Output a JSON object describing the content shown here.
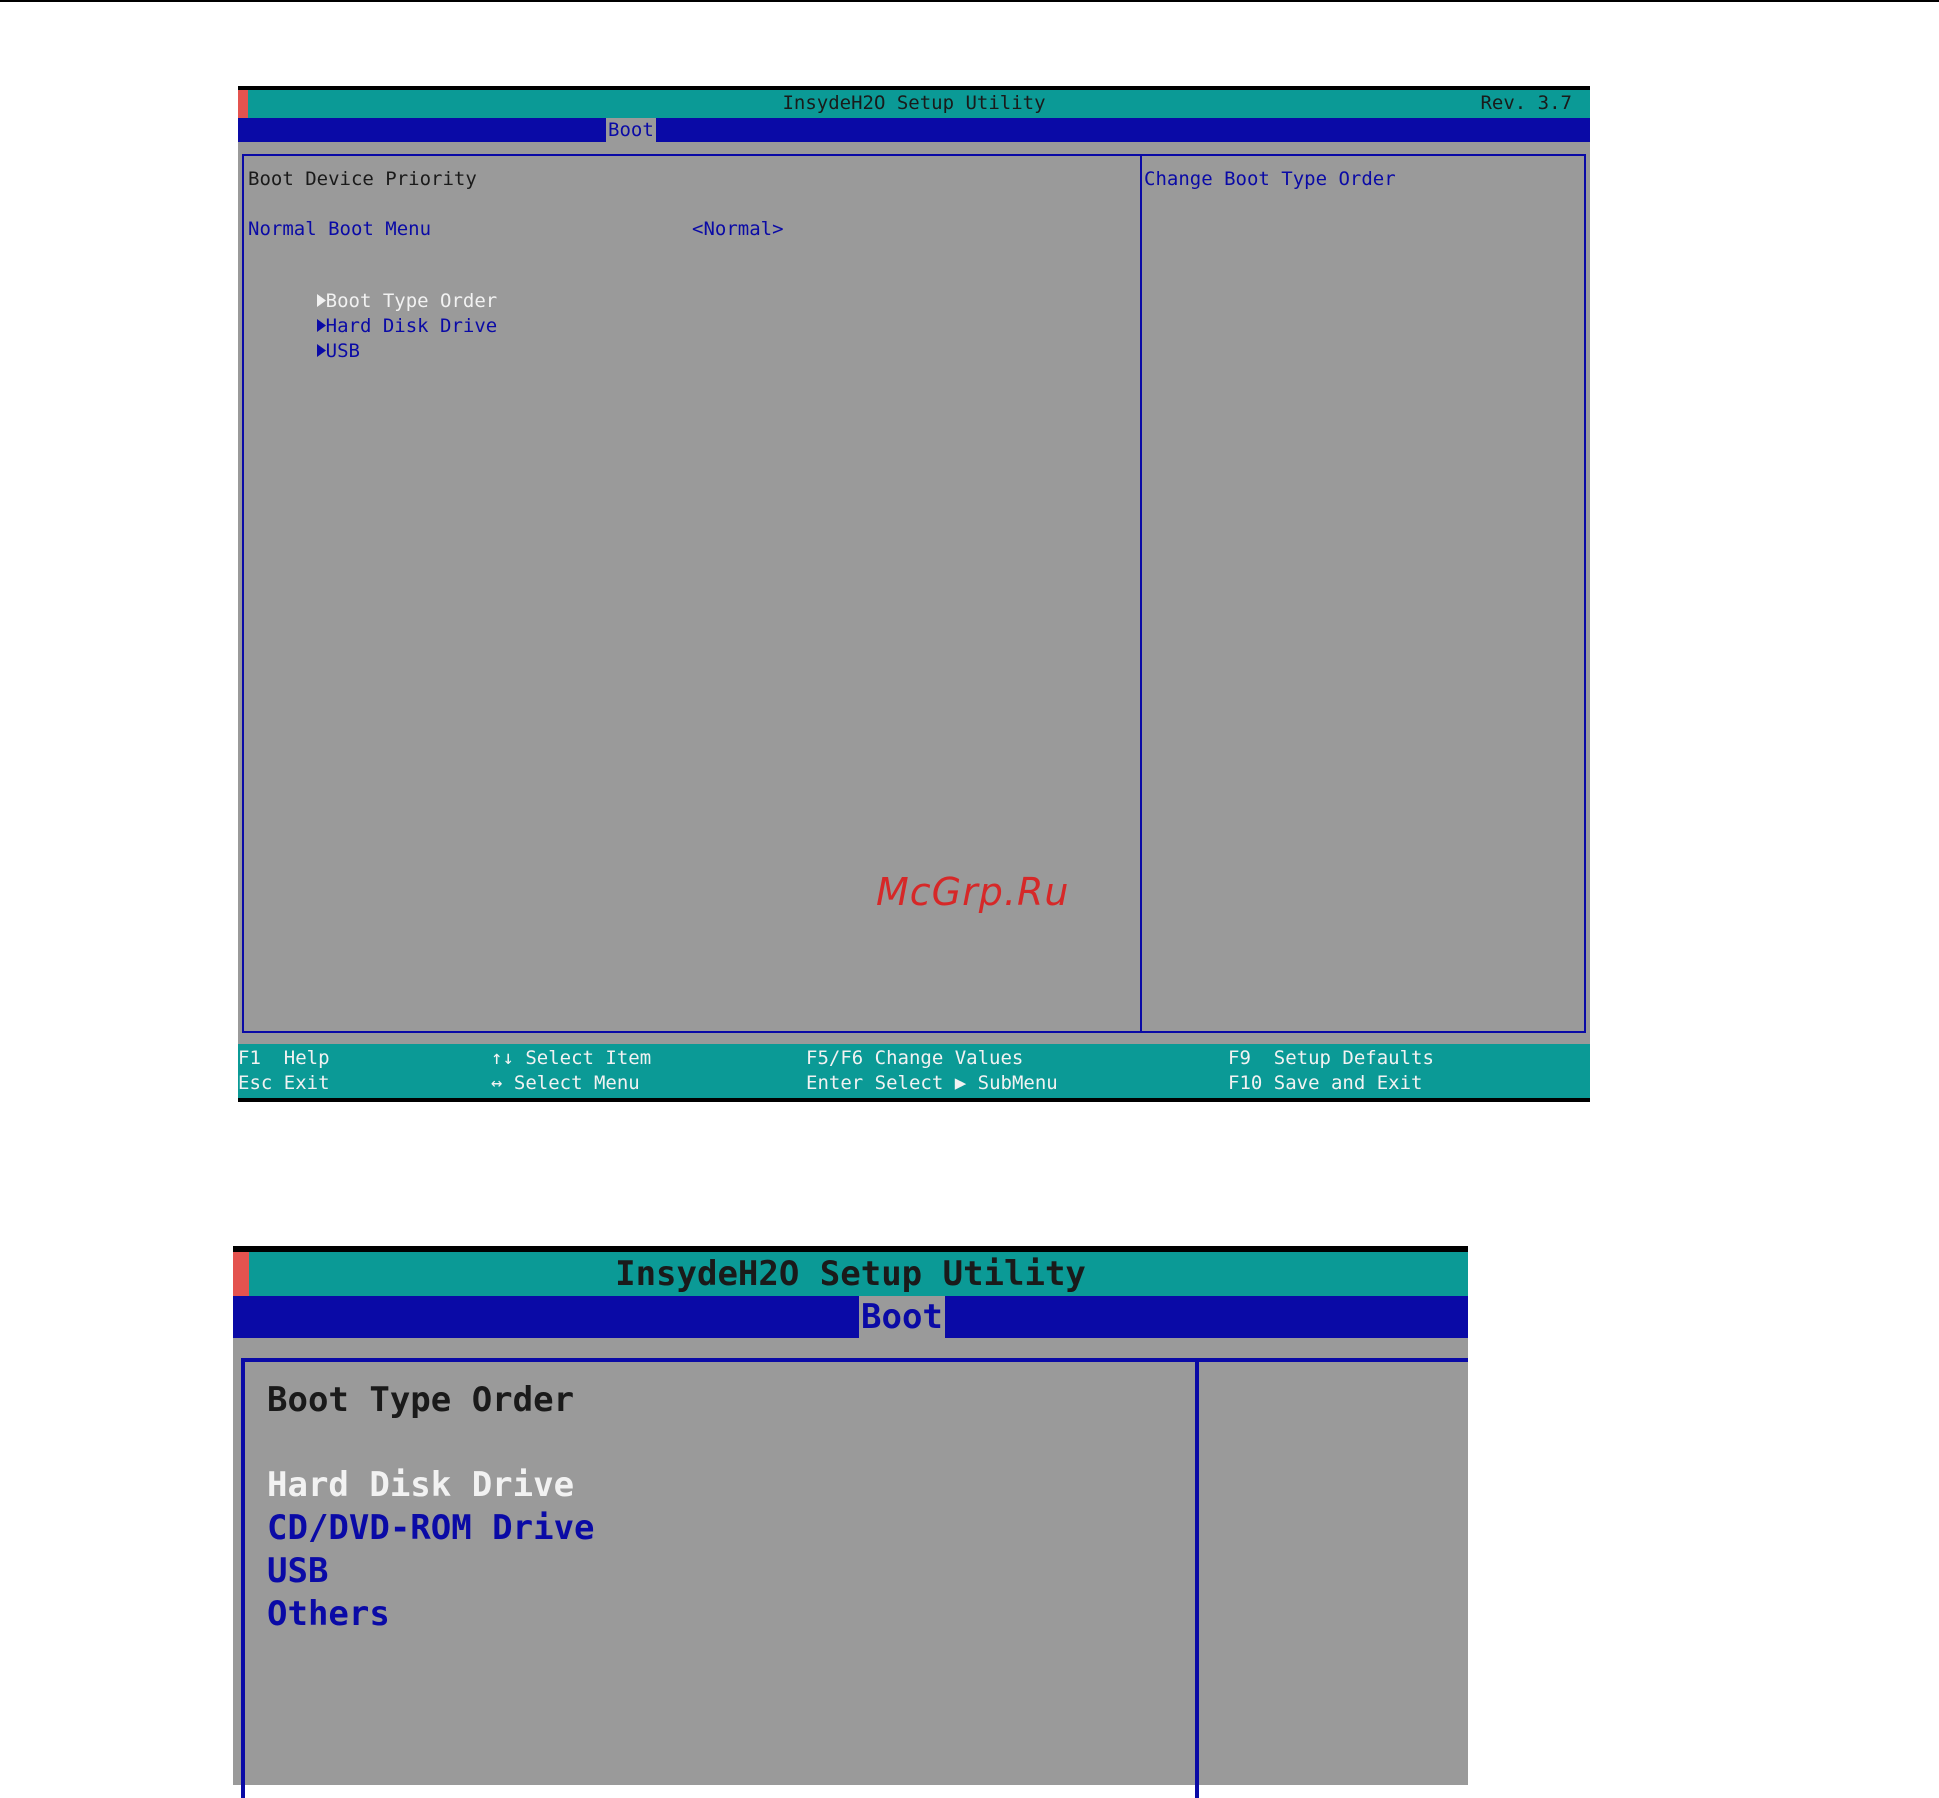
{
  "colors": {
    "header_teal": "#0b9a96",
    "nav_blue": "#0a0aa6",
    "panel_gray": "#9a9a9a",
    "selected_white": "#f2f2f2",
    "watermark_red": "#d62828"
  },
  "screen1": {
    "title": "InsydeH2O Setup Utility",
    "revision": "Rev. 3.7",
    "active_tab": "Boot",
    "section_heading": "Boot Device Priority",
    "normal_boot_menu": {
      "label": "Normal Boot Menu",
      "value": "<Normal>"
    },
    "submenus": [
      {
        "label": "Boot Type Order",
        "selected": true
      },
      {
        "label": "Hard Disk Drive",
        "selected": false
      },
      {
        "label": "USB",
        "selected": false
      }
    ],
    "submenu_arrow_icon": "triangle-right-icon",
    "help_text": "Change Boot Type Order",
    "footer": {
      "f1": "F1  Help",
      "esc": "Esc Exit",
      "select_item": "Select Item",
      "select_menu": "Select Menu",
      "change_values": "F5/F6 Change Values",
      "enter_select": "Enter Select",
      "submenu": "SubMenu",
      "setup_defaults": "F9  Setup Defaults",
      "save_exit": "F10 Save and Exit"
    }
  },
  "watermark": "McGrp.Ru",
  "screen2": {
    "title": "InsydeH2O Setup Utility",
    "active_tab": "Boot",
    "section_heading": "Boot Type Order",
    "items": [
      {
        "label": "Hard Disk Drive",
        "selected": true
      },
      {
        "label": "CD/DVD-ROM Drive",
        "selected": false
      },
      {
        "label": "USB",
        "selected": false
      },
      {
        "label": "Others",
        "selected": false
      }
    ]
  }
}
